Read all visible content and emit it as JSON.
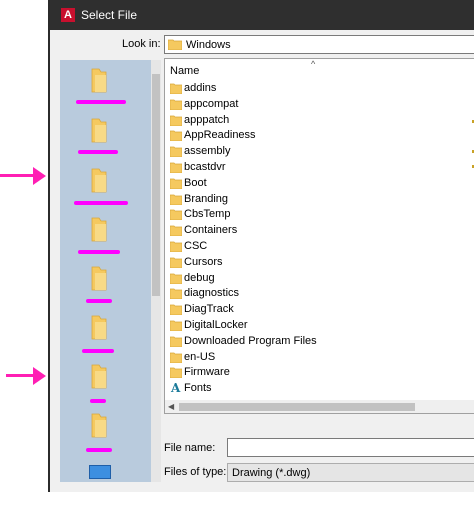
{
  "window": {
    "title": "Select File",
    "app_icon": "autocad-a-icon",
    "app_glyph": "A"
  },
  "look_in": {
    "label": "Look in:",
    "value": "Windows"
  },
  "file_list": {
    "column_header": "Name",
    "items": [
      {
        "label": "addins",
        "icon": "folder-icon"
      },
      {
        "label": "appcompat",
        "icon": "folder-icon"
      },
      {
        "label": "apppatch",
        "icon": "folder-icon"
      },
      {
        "label": "AppReadiness",
        "icon": "folder-icon"
      },
      {
        "label": "assembly",
        "icon": "folder-icon"
      },
      {
        "label": "bcastdvr",
        "icon": "folder-icon"
      },
      {
        "label": "Boot",
        "icon": "folder-icon"
      },
      {
        "label": "Branding",
        "icon": "folder-icon"
      },
      {
        "label": "CbsTemp",
        "icon": "folder-icon"
      },
      {
        "label": "Containers",
        "icon": "folder-icon"
      },
      {
        "label": "CSC",
        "icon": "folder-icon"
      },
      {
        "label": "Cursors",
        "icon": "folder-icon"
      },
      {
        "label": "debug",
        "icon": "folder-icon"
      },
      {
        "label": "diagnostics",
        "icon": "folder-icon"
      },
      {
        "label": "DiagTrack",
        "icon": "folder-icon"
      },
      {
        "label": "DigitalLocker",
        "icon": "folder-icon"
      },
      {
        "label": "Downloaded Program Files",
        "icon": "folder-icon"
      },
      {
        "label": "en-US",
        "icon": "folder-icon"
      },
      {
        "label": "Firmware",
        "icon": "folder-icon"
      },
      {
        "label": "Fonts",
        "icon": "fonts-folder-icon"
      }
    ]
  },
  "file_name": {
    "label": "File name:",
    "value": ""
  },
  "files_of_type": {
    "label": "Files of type:",
    "value": "Drawing (*.dwg)"
  },
  "colors": {
    "titlebar": "#2f2f2f",
    "folder": "#f5c95f",
    "annotation": "#ff1fb4",
    "places_bg": "#b9cbdd"
  }
}
